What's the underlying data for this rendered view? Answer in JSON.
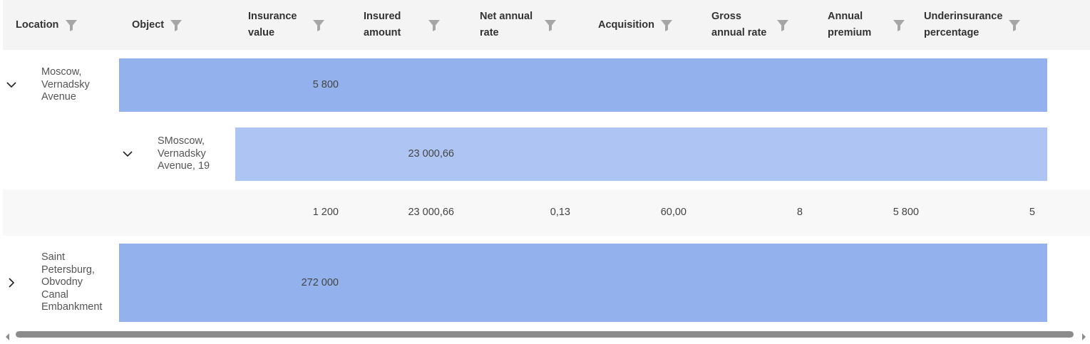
{
  "columns": [
    {
      "label_line1": "Location",
      "label_line2": ""
    },
    {
      "label_line1": "Object",
      "label_line2": ""
    },
    {
      "label_line1": "Insurance",
      "label_line2": "value"
    },
    {
      "label_line1": "Insured",
      "label_line2": "amount"
    },
    {
      "label_line1": "Net annual",
      "label_line2": "rate"
    },
    {
      "label_line1": "Acquisition",
      "label_line2": ""
    },
    {
      "label_line1": "Gross",
      "label_line2": "annual rate"
    },
    {
      "label_line1": "Annual",
      "label_line2": "premium"
    },
    {
      "label_line1": "Underinsurance",
      "label_line2": "percentage"
    }
  ],
  "groups": [
    {
      "location_lines": [
        "Moscow,",
        "Vernadsky",
        "Avenue"
      ],
      "expanded": true,
      "insurance_value": "5 800",
      "objects": [
        {
          "object_lines": [
            "SMoscow,",
            "Vernadsky",
            "Avenue, 19"
          ],
          "expanded": true,
          "insured_amount": "23 000,66",
          "detail": {
            "insurance_value": "1 200",
            "insured_amount": "23 000,66",
            "net_annual_rate": "0,13",
            "acquisition": "60,00",
            "gross_annual_rate": "8",
            "annual_premium": "5 800",
            "underinsurance_percentage": "5"
          }
        }
      ]
    },
    {
      "location_lines": [
        "Saint",
        "Petersburg,",
        "Obvodny",
        "Canal",
        "Embankment"
      ],
      "expanded": false,
      "insurance_value": "272 000"
    }
  ],
  "icons": {
    "filter": "filter-funnel-icon",
    "expanded": "chevron-down-icon",
    "collapsed": "chevron-right-icon"
  },
  "colors": {
    "group_band": "#93b1ec",
    "object_band": "#aec5f3",
    "header_bg": "#f4f4f4",
    "filter_icon": "#a6a6a6"
  }
}
